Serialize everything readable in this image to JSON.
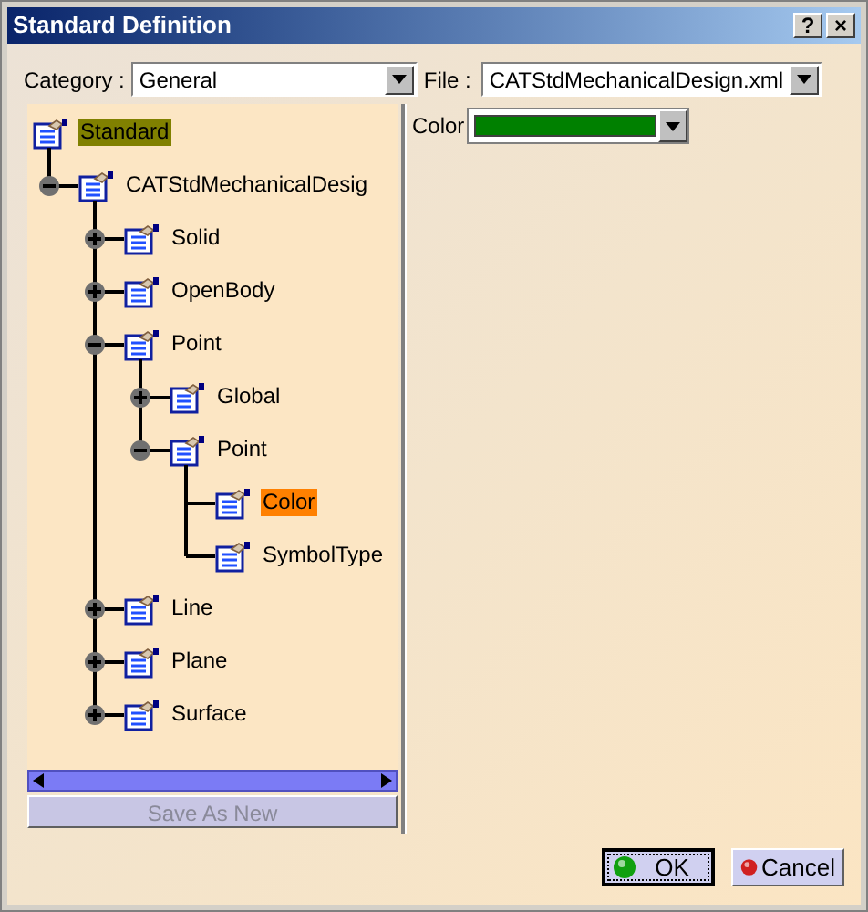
{
  "window": {
    "title": "Standard Definition",
    "title_buttons": [
      "?",
      "×"
    ]
  },
  "category": {
    "label": "Category :",
    "value": "General"
  },
  "file": {
    "label": "File :",
    "value": "CATStdMechanicalDesign.xml"
  },
  "tree": [
    {
      "label": "Standard",
      "selected": false,
      "focused": true,
      "children": [
        {
          "label": "CATStdMechanicalDesig",
          "selected": false,
          "focused": false,
          "expanded": true,
          "children": [
            {
              "label": "Solid",
              "selected": false,
              "focused": false,
              "expanded": false
            },
            {
              "label": "OpenBody",
              "selected": false,
              "focused": false,
              "expanded": false
            },
            {
              "label": "Point",
              "selected": false,
              "focused": false,
              "expanded": true,
              "children": [
                {
                  "label": "Global",
                  "selected": false,
                  "focused": false,
                  "expanded": false
                },
                {
                  "label": "Point",
                  "selected": false,
                  "focused": false,
                  "expanded": true,
                  "children": [
                    {
                      "label": "Color",
                      "selected": true,
                      "focused": false
                    },
                    {
                      "label": "SymbolType",
                      "selected": false,
                      "focused": false
                    }
                  ]
                }
              ]
            },
            {
              "label": "Line",
              "selected": false,
              "focused": false,
              "expanded": false
            },
            {
              "label": "Plane",
              "selected": false,
              "focused": false,
              "expanded": false
            },
            {
              "label": "Surface",
              "selected": false,
              "focused": false,
              "expanded": false
            }
          ]
        }
      ]
    }
  ],
  "save_button": {
    "label": "Save As New",
    "disabled": true
  },
  "property": {
    "label": "Color",
    "color": "#008000"
  },
  "buttons": [
    {
      "label": "OK",
      "kind": "ok",
      "default": true
    },
    {
      "label": "Cancel",
      "kind": "cancel",
      "default": false
    }
  ]
}
